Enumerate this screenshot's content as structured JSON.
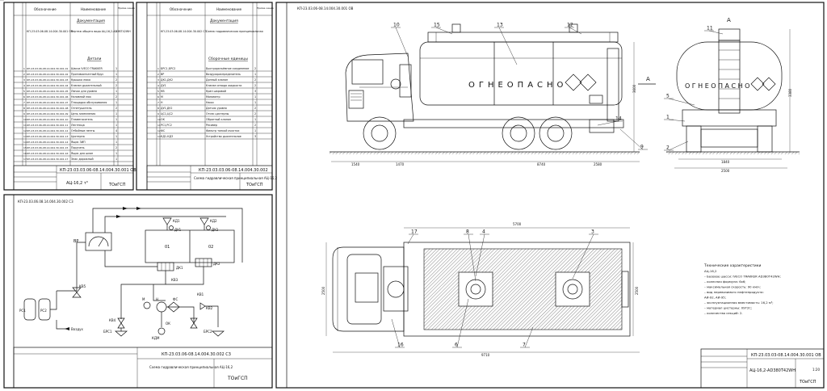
{
  "spec_left": {
    "headers": {
      "col2": "Обозначение",
      "col3": "Наименование",
      "col4": "Приме-чание"
    },
    "sections": {
      "doc": "Документация",
      "parts": "Детали"
    },
    "doc_rows": [
      [
        "КП-23.03.06-08.14.004.30.001 ОВ",
        "Чертеж общего вида АЦ-16,2-ADЭВТ42WH",
        "1"
      ]
    ],
    "part_rows": [
      [
        "1",
        "КП-23.03.06-08.14.004.30.001.01",
        "Шасси IVECO TRAKKER",
        "1"
      ],
      [
        "2",
        "КП-23.03.06-08.14.004.30.001.02",
        "Противооткатный брус",
        "1"
      ],
      [
        "3",
        "КП-23.03.06-08.14.004.30.001.03",
        "Крышка люка",
        "2"
      ],
      [
        "4",
        "КП-23.03.06-08.14.004.30.001.04",
        "Клапан дыхательный",
        "2"
      ],
      [
        "5",
        "КП-23.03.06-08.14.004.30.001.05",
        "Лючок для уровня",
        "1"
      ],
      [
        "6",
        "КП-23.03.06-08.14.004.30.001.06",
        "Наливной люк",
        "2"
      ],
      [
        "7",
        "КП-23.03.06-08.14.004.30.001.07",
        "Площадка обслуживания",
        "1"
      ],
      [
        "8",
        "КП-23.03.06-08.14.004.30.001.08",
        "Огнетушитель",
        "2"
      ],
      [
        "9",
        "КП-23.03.06-08.14.004.30.001.09",
        "Цепь заземления",
        "1"
      ],
      [
        "10",
        "КП-23.03.06-08.14.004.30.001.10",
        "Пламегаситель",
        "1"
      ],
      [
        "11",
        "КП-23.03.06-08.14.004.30.001.11",
        "Лестница",
        "1"
      ],
      [
        "12",
        "КП-23.03.06-08.14.004.30.001.12",
        "Отбойные ленты",
        "4"
      ],
      [
        "13",
        "КП-23.03.06-08.14.004.30.001.13",
        "Цистерна",
        "1"
      ],
      [
        "14",
        "КП-23.03.06-08.14.004.30.001.14",
        "Ящик ЗИП",
        "1"
      ],
      [
        "15",
        "КП-23.03.06-08.14.004.30.001.15",
        "Поручень",
        "2"
      ],
      [
        "16",
        "КП-23.03.06-08.14.004.30.001.16",
        "Ящик для шлан",
        "1"
      ],
      [
        "17",
        "КП-23.03.06-08.14.004.30.001.17",
        "Знак дорожный",
        "1"
      ]
    ],
    "stamp_code": "КП-23.03.03.06-08.14.004.30.001 ОВ",
    "stamp_title": "АЦ-16,2 т³",
    "stamp_org": "ТОиГСП"
  },
  "spec_right": {
    "headers": {
      "col2": "Обозначение",
      "col3": "Наименование",
      "col4": "Приме-чание"
    },
    "sections": {
      "doc": "Документация",
      "items": "Сборочные единицы"
    },
    "doc_rows": [
      [
        "КП-23.03.06-08.14.004.30.002 С3",
        "Схема гидравлическая принципиальная"
      ]
    ],
    "item_rows": [
      [
        "1",
        "БРС1,БРС2",
        "Быстроразъёмное соединение",
        "2"
      ],
      [
        "2",
        "ВР",
        "Воздухораспределитель",
        "1"
      ],
      [
        "3",
        "ДК1,ДК2",
        "Донный клапан",
        "2"
      ],
      [
        "4",
        "ДУ1",
        "Клапан отвода жидкости",
        "2"
      ],
      [
        "5",
        "КВ",
        "Кран шаровой",
        "3"
      ],
      [
        "6",
        "М",
        "Манометр",
        "1"
      ],
      [
        "7",
        "Н",
        "Насос",
        "1"
      ],
      [
        "8",
        "ДУ1,ДУ2",
        "Датчик уровня",
        "2"
      ],
      [
        "9",
        "ЦС1,ЦС2",
        "Отсек цистерны",
        "2"
      ],
      [
        "10",
        "ОК",
        "Обратный клапан",
        "1"
      ],
      [
        "11",
        "РС1,РС2",
        "Ресивер",
        "2"
      ],
      [
        "12",
        "ФС",
        "Фильтр тонкой очистки",
        "1"
      ],
      [
        "13",
        "КД1-КД3",
        "Устройство дыхательное",
        "3"
      ]
    ],
    "stamp_code": "КП-23.03.03.06-08.14.004.30.002",
    "stamp_title": "Схема гидравлическая принципиальная АЦ-16,2",
    "stamp_org": "ТОиГСП"
  },
  "scheme": {
    "corner": "КП-23.03.06.08.14.004.30.002 С3",
    "labels": {
      "vr": "ВР",
      "kv5": "КВ5",
      "rs1": "РС1",
      "rs2": "РС2",
      "vozduh": "Воздух",
      "kd1": "КД1",
      "kd2": "КД2",
      "du1": "ДУ1",
      "du2": "ДУ2",
      "c1": "01",
      "c2": "02",
      "dk1": "ДК1",
      "dk2": "ДК2",
      "kv3": "КВ3",
      "m": "М",
      "n": "Н",
      "fs": "ФС",
      "kv4": "КВ4",
      "kv1": "КВ1",
      "kv2": "КВ2",
      "ok": "ОК",
      "kdm": "КДМ",
      "brs1": "БРС1",
      "brs2": "БРС2"
    },
    "stamp_code": "КП-23.03.06-08.14.004.30.002 С3",
    "stamp_title": "Схема гидравлическая принципиальная АЦ-16,2",
    "stamp_org": "ТОиГСП"
  },
  "assembly": {
    "corner": "КП-23.03.06-08.14.004.30.001 ОВ",
    "tank_text": "ОГНЕОПАСНО",
    "view_a": "А",
    "arrow_a": "А",
    "side_callouts": [
      "10",
      "15",
      "13",
      "12",
      "14",
      "9"
    ],
    "front_callouts": [
      "11",
      "5",
      "1",
      "2"
    ],
    "plan_callouts": [
      "17",
      "8",
      "4",
      "3",
      "16",
      "6",
      "7"
    ],
    "dims": {
      "front_overhang": "1540",
      "wheelbase1": "1470",
      "wheelbase2": "8740",
      "rear_overhang": "2580",
      "height": "3600",
      "plan_length": "5700",
      "plan_total": "9710",
      "plan_width": "2500",
      "front_width": "2500",
      "front_track": "1840",
      "front_height": "3380",
      "tank_w": "2500"
    },
    "tech_title": "Технические характеристики",
    "tech_lines": [
      "АЦ-16,2",
      "– Базовое шасси: IVECO TRAKKER AD380T42WH;",
      "– колесная формула: 6х6;",
      "– максимальная скорость: 90 км/ч;",
      "– вид перевозимого нефтепродукта:",
      "  АИ-92, АИ-95;",
      "– эксплуатационная вместимость: 16,2 м³;",
      "– материал цистерны: 09Г2С;",
      "– количество секций: 2."
    ],
    "stamp_code": "КП-23.03.03-08.14.004.30.001 ОВ",
    "stamp_title": "АЦ-16,2-AD380T42WH",
    "stamp_org": "ТОиГСП",
    "stamp_mass": "1:20"
  }
}
